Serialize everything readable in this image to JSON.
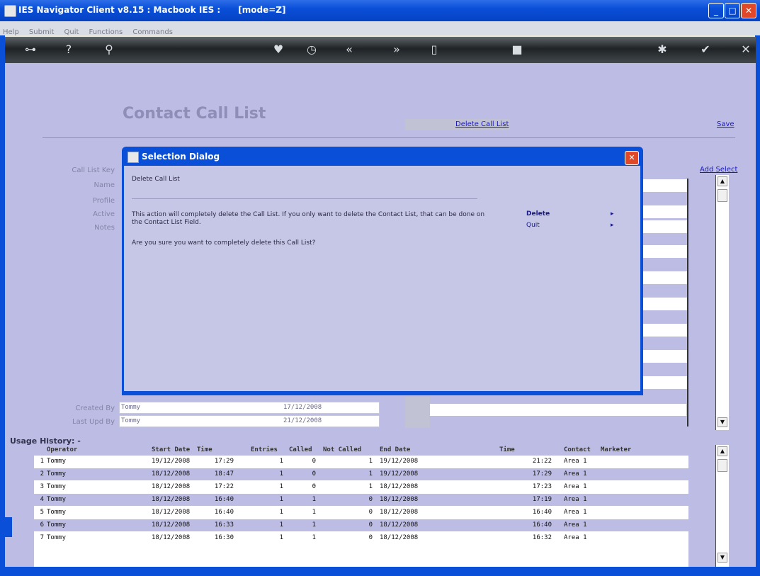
{
  "window": {
    "title": "IES Navigator Client v8.15 : Macbook IES :      [mode=Z]"
  },
  "menu": [
    "Help",
    "Submit",
    "Quit",
    "Functions",
    "Commands"
  ],
  "page": {
    "title": "Contact Call List",
    "delete_link": "Delete Call List",
    "save_link": "Save",
    "add_select_link": "Add Select"
  },
  "form": {
    "labels": [
      "Call List Key",
      "Name",
      "Profile",
      "Active",
      "Notes"
    ],
    "created_by_label": "Created By",
    "last_upd_by_label": "Last Upd By",
    "created_by_value": "Tommy",
    "created_date": "17/12/2008",
    "last_upd_by_value": "Tommy",
    "last_upd_date": "21/12/2008"
  },
  "dialog": {
    "title": "Selection Dialog",
    "heading": "Delete Call List",
    "message": "This action will completely delete the Call List. If you only want to delete the Contact List, that can be done on the Contact List Field.",
    "question": "Are you sure you want to completely delete this Call List?",
    "options": [
      {
        "label": "Delete",
        "arrow": "▸"
      },
      {
        "label": "Quit",
        "arrow": "▸"
      }
    ]
  },
  "usage": {
    "title": "Usage History: -",
    "headers": [
      "Operator",
      "Start Date",
      "Time",
      "Entries",
      "Called",
      "Not Called",
      "End Date",
      "Time",
      "Contact",
      "Marketer"
    ],
    "rows": [
      {
        "n": "1",
        "op": "Tommy",
        "sd": "19/12/2008",
        "st": "17:29",
        "en": "1",
        "ca": "0",
        "nc": "1",
        "ed": "19/12/2008",
        "et": "21:22",
        "ct": "Area 1"
      },
      {
        "n": "2",
        "op": "Tommy",
        "sd": "18/12/2008",
        "st": "18:47",
        "en": "1",
        "ca": "0",
        "nc": "1",
        "ed": "19/12/2008",
        "et": "17:29",
        "ct": "Area 1"
      },
      {
        "n": "3",
        "op": "Tommy",
        "sd": "18/12/2008",
        "st": "17:22",
        "en": "1",
        "ca": "0",
        "nc": "1",
        "ed": "18/12/2008",
        "et": "17:23",
        "ct": "Area 1"
      },
      {
        "n": "4",
        "op": "Tommy",
        "sd": "18/12/2008",
        "st": "16:40",
        "en": "1",
        "ca": "1",
        "nc": "0",
        "ed": "18/12/2008",
        "et": "17:19",
        "ct": "Area 1"
      },
      {
        "n": "5",
        "op": "Tommy",
        "sd": "18/12/2008",
        "st": "16:40",
        "en": "1",
        "ca": "1",
        "nc": "0",
        "ed": "18/12/2008",
        "et": "16:40",
        "ct": "Area 1"
      },
      {
        "n": "6",
        "op": "Tommy",
        "sd": "18/12/2008",
        "st": "16:33",
        "en": "1",
        "ca": "1",
        "nc": "0",
        "ed": "18/12/2008",
        "et": "16:40",
        "ct": "Area 1"
      },
      {
        "n": "7",
        "op": "Tommy",
        "sd": "18/12/2008",
        "st": "16:30",
        "en": "1",
        "ca": "1",
        "nc": "0",
        "ed": "18/12/2008",
        "et": "16:32",
        "ct": "Area 1"
      }
    ]
  },
  "colors": {
    "titlebar": "#0a4fd8",
    "app_bg": "#bcbce4",
    "stripe": "#bcbce4",
    "link": "#1a1ac8"
  }
}
